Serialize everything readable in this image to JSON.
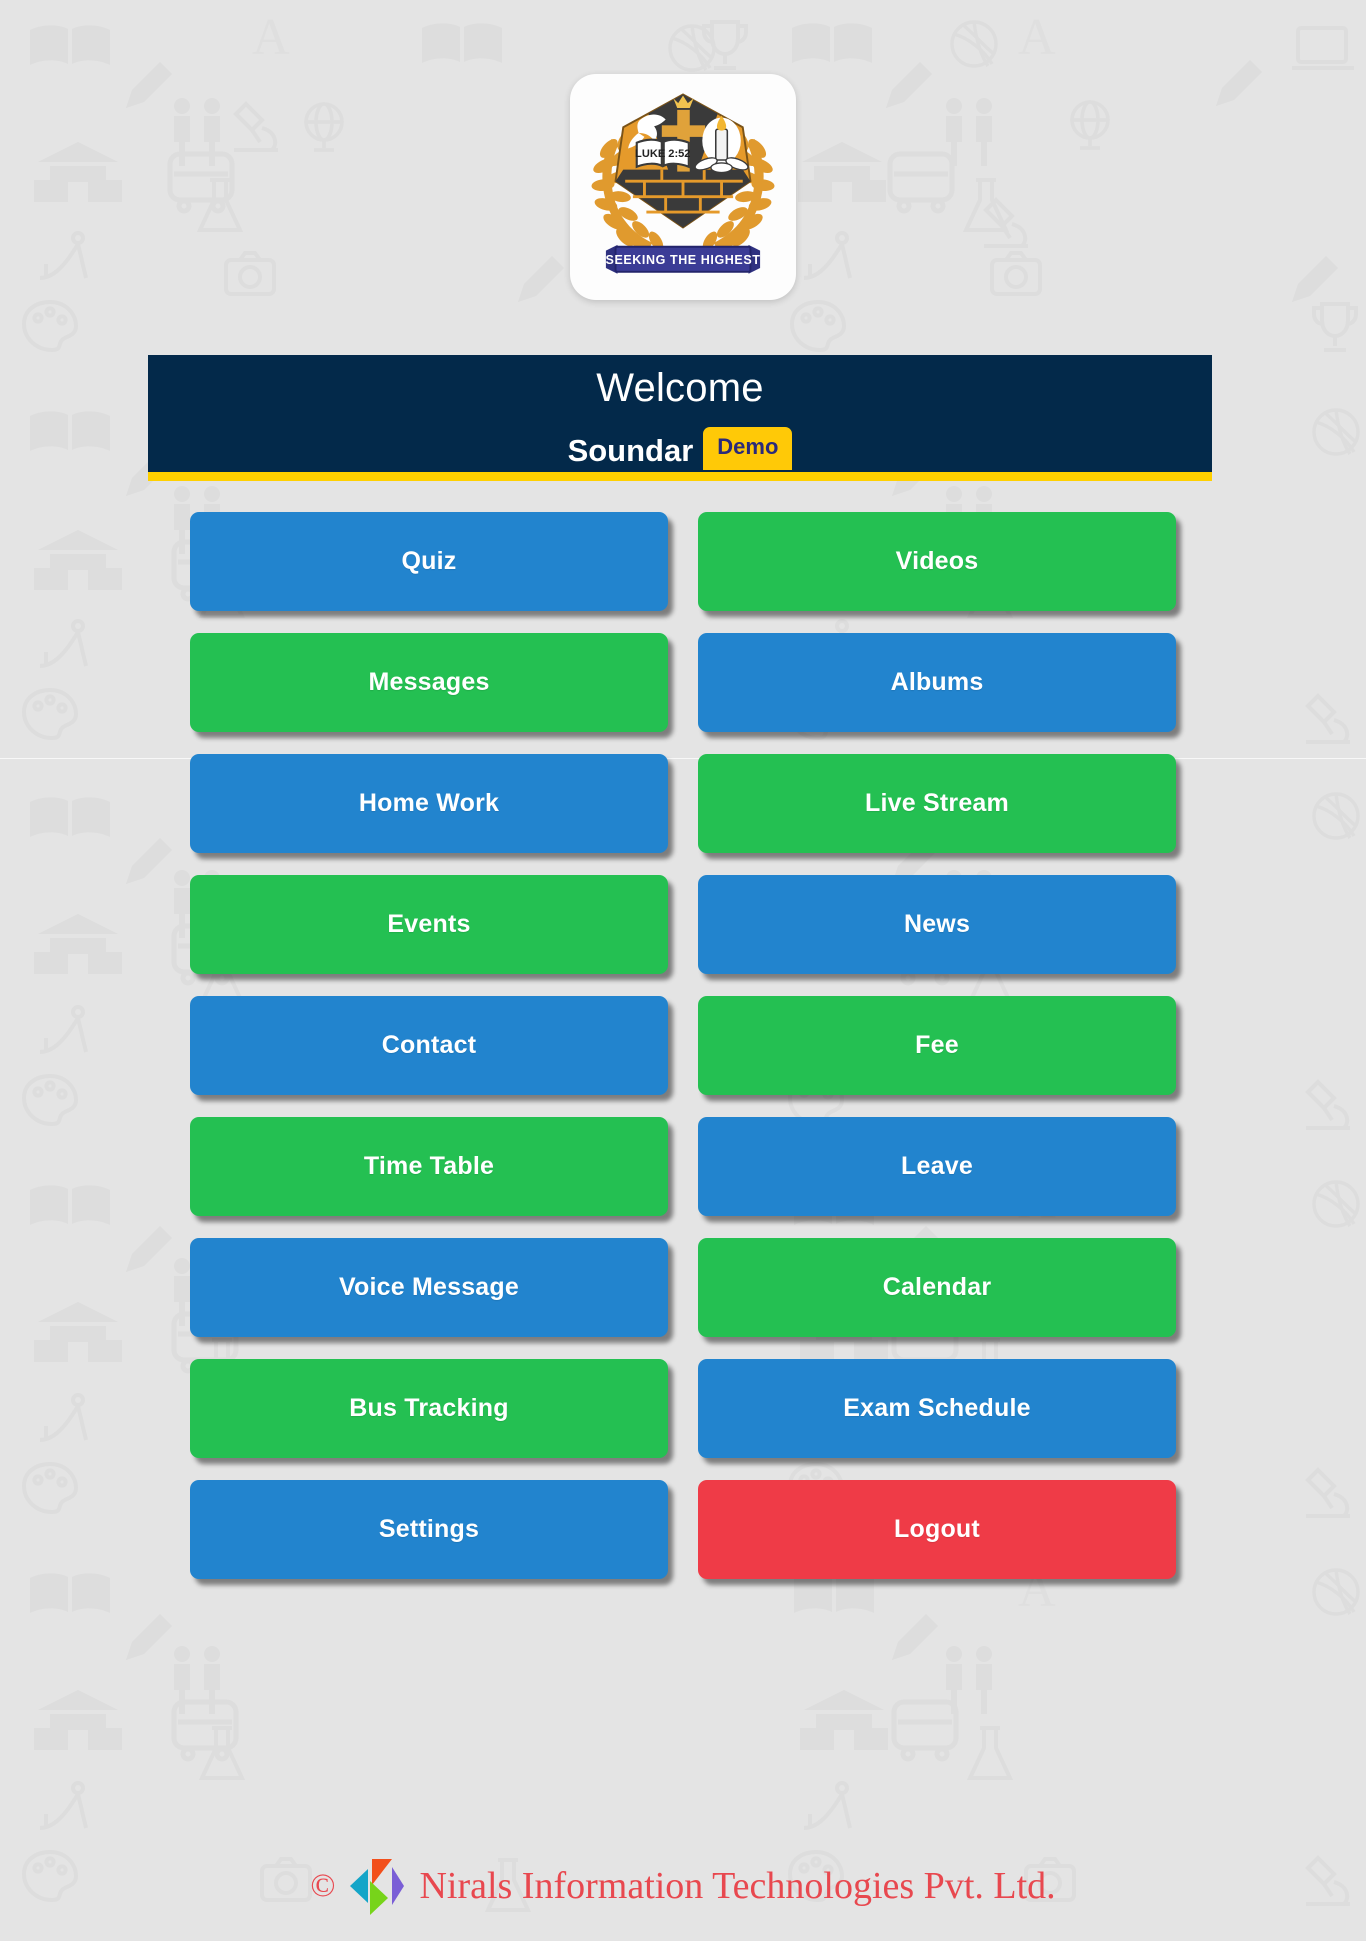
{
  "app": {
    "background_color": "#e4e4e4",
    "logo": {
      "icon": "school-crest-logo",
      "book_text": "LUKE 2:52",
      "banner_text": "SEEKING THE HIGHEST",
      "crest_color": "#e59a2b",
      "banner_color": "#3b3c96"
    }
  },
  "header": {
    "title": "Welcome",
    "user_name": "Soundar",
    "badge_label": "Demo",
    "background_color": "#03294a",
    "accent_color": "#ffd000",
    "badge_background": "#ffc907",
    "badge_text_color": "#2b2a7a"
  },
  "menu": {
    "colors": {
      "blue": "#2284ce",
      "green": "#24c052",
      "red": "#ef3b47"
    },
    "items": [
      {
        "label": "Quiz",
        "color": "blue",
        "name": "quiz"
      },
      {
        "label": "Videos",
        "color": "green",
        "name": "videos"
      },
      {
        "label": "Messages",
        "color": "green",
        "name": "messages"
      },
      {
        "label": "Albums",
        "color": "blue",
        "name": "albums"
      },
      {
        "label": "Home Work",
        "color": "blue",
        "name": "home-work"
      },
      {
        "label": "Live Stream",
        "color": "green",
        "name": "live-stream"
      },
      {
        "label": "Events",
        "color": "green",
        "name": "events"
      },
      {
        "label": "News",
        "color": "blue",
        "name": "news"
      },
      {
        "label": "Contact",
        "color": "blue",
        "name": "contact"
      },
      {
        "label": "Fee",
        "color": "green",
        "name": "fee"
      },
      {
        "label": "Time Table",
        "color": "green",
        "name": "time-table"
      },
      {
        "label": "Leave",
        "color": "blue",
        "name": "leave"
      },
      {
        "label": "Voice Message",
        "color": "blue",
        "name": "voice-message"
      },
      {
        "label": "Calendar",
        "color": "green",
        "name": "calendar"
      },
      {
        "label": "Bus Tracking",
        "color": "green",
        "name": "bus-tracking"
      },
      {
        "label": "Exam Schedule",
        "color": "blue",
        "name": "exam-schedule"
      },
      {
        "label": "Settings",
        "color": "blue",
        "name": "settings"
      },
      {
        "label": "Logout",
        "color": "red",
        "name": "logout"
      }
    ]
  },
  "footer": {
    "copyright_symbol": "©",
    "company": "Nirals Information Technologies Pvt. Ltd.",
    "text_color": "#e8484f",
    "logo_icon": "nirals-n-logo",
    "logo_colors": [
      "#14a5c8",
      "#f24f1c",
      "#77d41a",
      "#7a5ed6"
    ]
  }
}
